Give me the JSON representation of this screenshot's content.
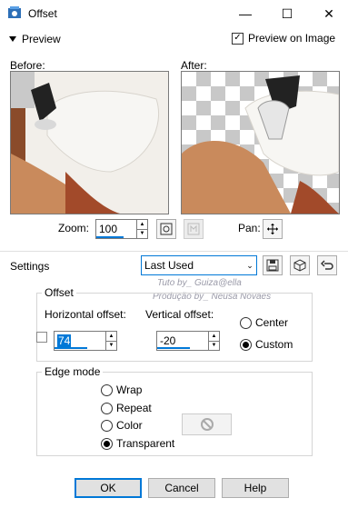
{
  "window": {
    "title": "Offset",
    "minimize": "—",
    "maximize": "☐",
    "close": "✕"
  },
  "preview": {
    "toggle_label": "Preview",
    "on_image_label": "Preview on Image",
    "on_image_checked": true,
    "before_label": "Before:",
    "after_label": "After:"
  },
  "zoom": {
    "label": "Zoom:",
    "value": "100"
  },
  "pan": {
    "label": "Pan:"
  },
  "settings": {
    "label": "Settings",
    "preset": "Last Used"
  },
  "watermark": {
    "line1": "Tuto by_ Guiza@ella",
    "line2": "Produção by_ Neusa Novaes"
  },
  "offset": {
    "group_label": "Offset",
    "horizontal_label": "Horizontal offset:",
    "horizontal_value": "74",
    "vertical_label": "Vertical offset:",
    "vertical_value": "-20",
    "options": [
      "Center",
      "Custom"
    ],
    "selected": "Custom"
  },
  "edge_mode": {
    "group_label": "Edge mode",
    "options": [
      "Wrap",
      "Repeat",
      "Color",
      "Transparent"
    ],
    "selected": "Transparent"
  },
  "buttons": {
    "ok": "OK",
    "cancel": "Cancel",
    "help": "Help"
  },
  "colors": {
    "accent": "#0078d7"
  }
}
